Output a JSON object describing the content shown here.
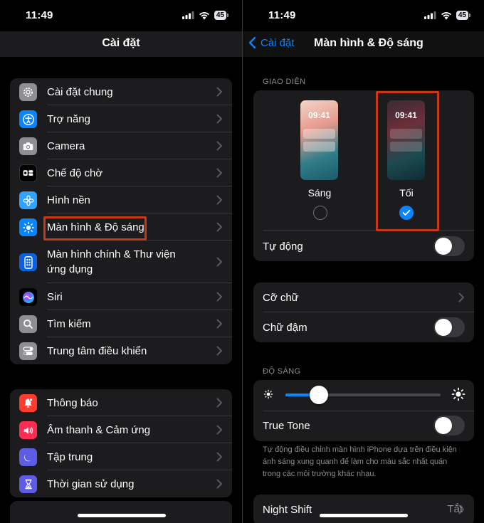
{
  "left": {
    "status": {
      "time": "11:49",
      "battery": "45"
    },
    "title": "Cài đặt",
    "group1": [
      {
        "label": "Cài đặt chung",
        "icon": "gear-icon",
        "color": "#8e8e93"
      },
      {
        "label": "Trợ năng",
        "icon": "accessibility-icon",
        "color": "#0a84ff"
      },
      {
        "label": "Camera",
        "icon": "camera-icon",
        "color": "#8e8e93"
      },
      {
        "label": "Chế độ chờ",
        "icon": "standby-icon",
        "color": "#1c1c1e"
      },
      {
        "label": "Hình nền",
        "icon": "wallpaper-flower-icon",
        "color": "#30a2ff"
      },
      {
        "label": "Màn hình & Độ sáng",
        "icon": "sun-icon",
        "color": "#0a84ff"
      },
      {
        "label": "Màn hình chính & Thư viện",
        "label2": "ứng dụng",
        "icon": "home-screen-icon",
        "color": "#0a62e0"
      },
      {
        "label": "Siri",
        "icon": "siri-icon",
        "color": "#000000"
      },
      {
        "label": "Tìm kiếm",
        "icon": "search-icon",
        "color": "#8e8e93"
      },
      {
        "label": "Trung tâm điều khiển",
        "icon": "control-center-icon",
        "color": "#8e8e93"
      }
    ],
    "group2": [
      {
        "label": "Thông báo",
        "icon": "bell-icon",
        "color": "#ff3b30"
      },
      {
        "label": "Âm thanh & Cảm ứng",
        "icon": "speaker-icon",
        "color": "#ff2d55"
      },
      {
        "label": "Tập trung",
        "icon": "moon-icon",
        "color": "#5e5ce6"
      },
      {
        "label": "Thời gian sử dụng",
        "icon": "hourglass-icon",
        "color": "#5e5ce6"
      }
    ]
  },
  "right": {
    "status": {
      "time": "11:49",
      "battery": "45"
    },
    "back_label": "Cài đặt",
    "title": "Màn hình & Độ sáng",
    "appearance_section": "GIAO DIỆN",
    "preview_time": "09:41",
    "light_label": "Sáng",
    "dark_label": "Tối",
    "selected_mode": "dark",
    "automatic_label": "Tự động",
    "automatic_on": false,
    "text_size_label": "Cỡ chữ",
    "bold_text_label": "Chữ đậm",
    "bold_text_on": false,
    "brightness_section": "ĐỘ SÁNG",
    "brightness_level": 0.17,
    "true_tone_label": "True Tone",
    "true_tone_on": false,
    "true_tone_note": "Tự động điều chỉnh màn hình iPhone dựa trên điều kiện ánh sáng xung quanh để làm cho màu sắc nhất quán trong các môi trường khác nhau.",
    "night_shift_label": "Night Shift",
    "night_shift_value": "Tắt"
  },
  "colors": {
    "accent": "#0a84ff",
    "highlight": "#c8391b"
  }
}
